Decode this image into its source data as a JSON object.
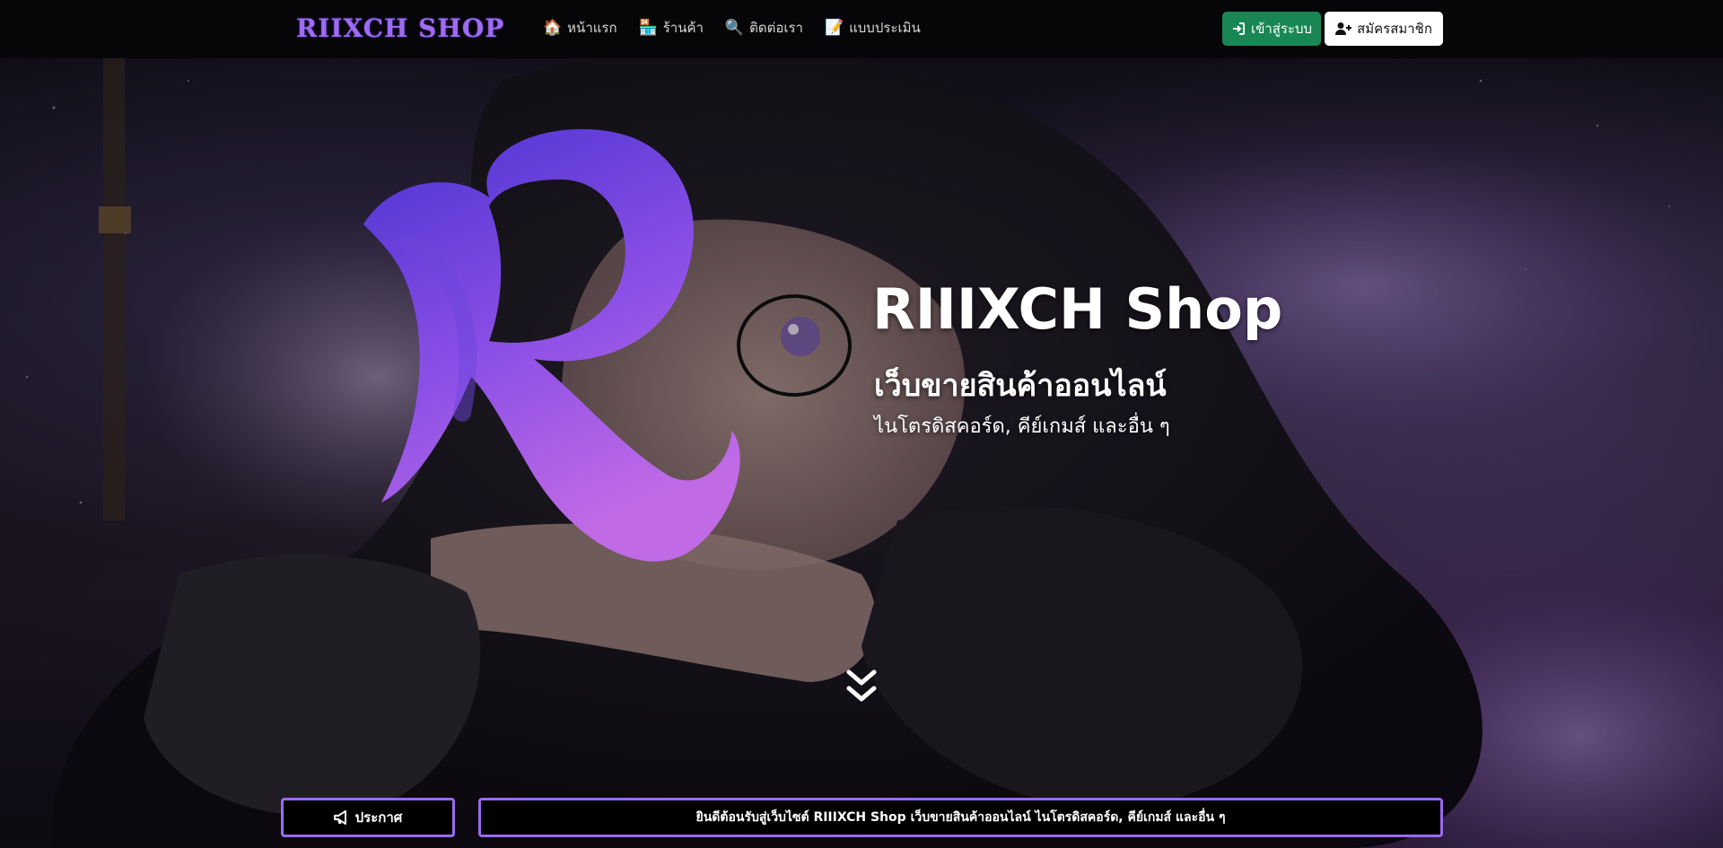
{
  "brand": {
    "name": "RIIXCH SHOP"
  },
  "nav": {
    "items": [
      {
        "label": "หน้าแรก",
        "icon": "home-icon"
      },
      {
        "label": "ร้านค้า",
        "icon": "store-icon"
      },
      {
        "label": "ติดต่อเรา",
        "icon": "search-icon"
      },
      {
        "label": "แบบประเมิน",
        "icon": "form-icon"
      }
    ],
    "login_label": "เข้าสู่ระบบ",
    "register_label": "สมัครสมาชิก"
  },
  "hero": {
    "title": "RIIIXCH Shop",
    "subtitle": "เว็บขายสินค้าออนไลน์",
    "description": "ไนโตรดิสคอร์ด, คีย์เกมส์ และอื่น ๆ"
  },
  "announcement": {
    "label": "ประกาศ",
    "text": "ยินดีต้อนรับสู่เว็บไซต์ RIIIXCH Shop เว็บขายสินค้าออนไลน์ ไนโตรดิสคอร์ด, คีย์เกมส์ และอื่น ๆ"
  },
  "colors": {
    "accent": "#9a6af0",
    "login_button": "#198754",
    "navbar": "#050508"
  }
}
